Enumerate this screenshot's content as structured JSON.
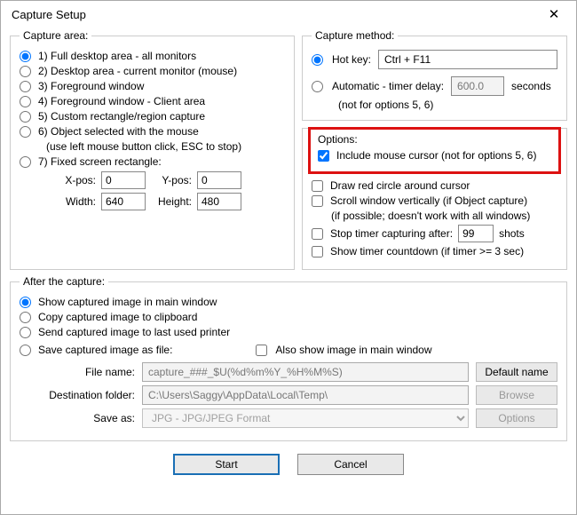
{
  "title": "Capture Setup",
  "captureArea": {
    "legend": "Capture area:",
    "opt1": "1) Full desktop area - all monitors",
    "opt2": "2) Desktop area - current monitor (mouse)",
    "opt3": "3) Foreground window",
    "opt4": "4) Foreground window - Client area",
    "opt5": "5) Custom rectangle/region capture",
    "opt6": "6) Object selected with the mouse",
    "opt6note": "(use left mouse button click, ESC to stop)",
    "opt7": "7) Fixed screen rectangle:",
    "xposLabel": "X-pos:",
    "xpos": "0",
    "yposLabel": "Y-pos:",
    "ypos": "0",
    "widthLabel": "Width:",
    "width": "640",
    "heightLabel": "Height:",
    "height": "480"
  },
  "captureMethod": {
    "legend": "Capture method:",
    "hotkeyLabel": "Hot key:",
    "hotkeyValue": "Ctrl + F11",
    "autoLabel": "Automatic - timer delay:",
    "autoNote": "(not for options 5, 6)",
    "autoValue": "600.0",
    "autoUnit": "seconds"
  },
  "options": {
    "title": "Options:",
    "includeCursor": "Include mouse cursor (not for options 5, 6)",
    "drawCircle": "Draw red circle around cursor",
    "scrollWindow": "Scroll window vertically (if Object capture)",
    "scrollWindowNote": "(if possible; doesn't work with all windows)",
    "stopTimerLabel": "Stop timer capturing after:",
    "stopTimerValue": "99",
    "stopTimerUnit": "shots",
    "showCountdown": "Show timer countdown (if timer >= 3 sec)"
  },
  "after": {
    "legend": "After the capture:",
    "showMain": "Show captured image in main window",
    "copyClip": "Copy captured image to clipboard",
    "sendPrinter": "Send captured image to last used printer",
    "saveFile": "Save captured image as file:",
    "alsoShow": "Also show image in main window",
    "fileNameLabel": "File name:",
    "fileNameValue": "capture_###_$U(%d%m%Y_%H%M%S)",
    "defaultNameBtn": "Default name",
    "destLabel": "Destination folder:",
    "destValue": "C:\\Users\\Saggy\\AppData\\Local\\Temp\\",
    "browseBtn": "Browse",
    "saveAsLabel": "Save as:",
    "saveAsValue": "JPG - JPG/JPEG Format",
    "optionsBtn": "Options"
  },
  "buttons": {
    "start": "Start",
    "cancel": "Cancel"
  }
}
